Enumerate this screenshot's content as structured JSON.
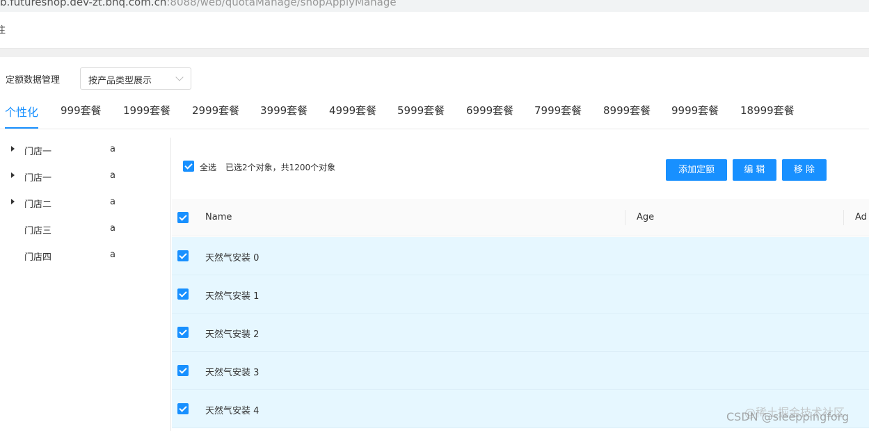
{
  "browser": {
    "url_host": "b.futureshop.dev-zt.bnq.com.cn",
    "url_path": ":8088/web/quotaManage/shopApplyManage"
  },
  "header": {
    "fragment": "注"
  },
  "filter": {
    "label": "定额数据管理",
    "select_value": "按产品类型展示"
  },
  "tabs": [
    {
      "label": "个性化",
      "active": true
    },
    {
      "label": "999套餐"
    },
    {
      "label": "1999套餐"
    },
    {
      "label": "2999套餐"
    },
    {
      "label": "3999套餐"
    },
    {
      "label": "4999套餐"
    },
    {
      "label": "5999套餐"
    },
    {
      "label": "6999套餐"
    },
    {
      "label": "7999套餐"
    },
    {
      "label": "8999套餐"
    },
    {
      "label": "9999套餐"
    },
    {
      "label": "18999套餐"
    }
  ],
  "tree": [
    {
      "title": "门店一",
      "extra": "a",
      "expandable": true
    },
    {
      "title": "门店一",
      "extra": "a",
      "expandable": true
    },
    {
      "title": "门店二",
      "extra": "a",
      "expandable": true
    },
    {
      "title": "门店三",
      "extra": "a",
      "expandable": false
    },
    {
      "title": "门店四",
      "extra": "a",
      "expandable": false
    }
  ],
  "toolbar": {
    "select_all_label": "全选",
    "summary": "已选2个对象，共1200个对象",
    "add_label": "添加定额",
    "edit_label": "编 辑",
    "remove_label": "移 除"
  },
  "table": {
    "columns": [
      "Name",
      "Age",
      "Ad"
    ],
    "rows": [
      {
        "name": "天然气安装 0",
        "checked": true
      },
      {
        "name": "天然气安装 1",
        "checked": true
      },
      {
        "name": "天然气安装 2",
        "checked": true
      },
      {
        "name": "天然气安装 3",
        "checked": true
      },
      {
        "name": "天然气安装 4",
        "checked": true
      }
    ]
  },
  "watermark": {
    "line1": "@稀土掘金技术社区",
    "line2": "CSDN @sleeppingforg"
  },
  "colors": {
    "primary": "#1890ff",
    "row_selected_bg": "#e6f7ff",
    "header_bg": "#fafafa"
  }
}
